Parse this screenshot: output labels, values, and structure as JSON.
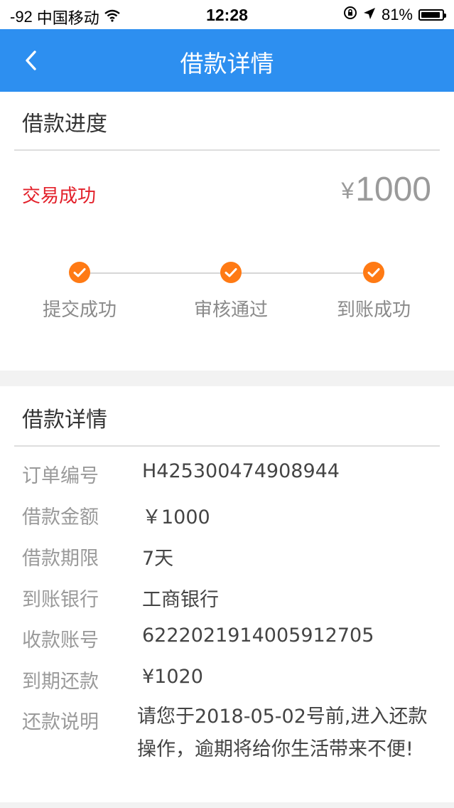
{
  "status_bar": {
    "signal": "-92",
    "carrier": "中国移动",
    "time": "12:28",
    "battery": "81%",
    "wifi_icon": "wifi-icon",
    "lock_icon": "rotation-lock-icon",
    "location_icon": "location-arrow-icon"
  },
  "nav": {
    "title": "借款详情",
    "back_icon": "chevron-left-icon"
  },
  "progress": {
    "title": "借款进度",
    "status": "交易成功",
    "currency": "¥",
    "amount": "1000",
    "steps": [
      {
        "label": "提交成功"
      },
      {
        "label": "审核通过"
      },
      {
        "label": "到账成功"
      }
    ]
  },
  "details": {
    "title": "借款详情",
    "rows": [
      {
        "label": "订单编号",
        "value": "H425300474908944"
      },
      {
        "label": "借款金额",
        "value": "￥1000"
      },
      {
        "label": "借款期限",
        "value": "7天"
      },
      {
        "label": "到账银行",
        "value": "工商银行"
      },
      {
        "label": "收款账号",
        "value": "6222021914005912705"
      },
      {
        "label": "到期还款",
        "value": "¥1020"
      },
      {
        "label": "还款说明",
        "value": "请您于2018-05-02号前,进入还款操作，逾期将给你生活带来不便!"
      }
    ]
  },
  "colors": {
    "brand_blue": "#2d8ff0",
    "status_red": "#e3202a",
    "step_orange": "#ff7a14"
  }
}
